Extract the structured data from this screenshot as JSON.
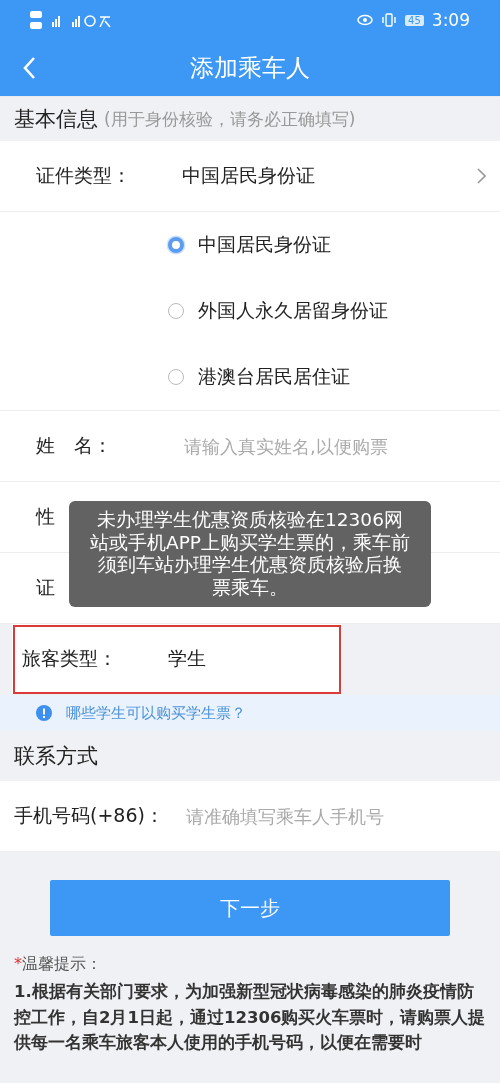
{
  "status_bar": {
    "time": "3:09",
    "battery": "45"
  },
  "header": {
    "title": "添加乘车人"
  },
  "basic_section": {
    "title": "基本信息",
    "note": "(用于身份核验，请务必正确填写)"
  },
  "id_type": {
    "label": "证件类型：",
    "value": "中国居民身份证"
  },
  "id_options": [
    {
      "label": "中国居民身份证",
      "selected": true
    },
    {
      "label": "外国人永久居留身份证",
      "selected": false
    },
    {
      "label": "港澳台居民居住证",
      "selected": false
    }
  ],
  "fields": [
    {
      "kind": "input",
      "label": "姓　名：",
      "placeholder": "请输入真实姓名,以便购票"
    },
    {
      "kind": "label",
      "label": "性"
    },
    {
      "kind": "label",
      "label": "证"
    },
    {
      "kind": "value",
      "label": "旅客类型：",
      "value": "学生",
      "highlighted": true
    }
  ],
  "toast": "未办理学生优惠资质核验在12306网站或手机APP上购买学生票的，乘车前须到车站办理学生优惠资质核验后换票乘车。",
  "student_link": "哪些学生可以购买学生票？",
  "contact_section": {
    "title": "联系方式"
  },
  "phone": {
    "label": "手机号码(+86)：",
    "placeholder": "请准确填写乘车人手机号"
  },
  "next_button": "下一步",
  "tips": {
    "mark": "*",
    "title": "温馨提示：",
    "text": "1.根据有关部门要求，为加强新型冠状病毒感染的肺炎疫情防控工作，自2月1日起，通过12306购买火车票时，请购票人提供每一名乘车旅客本人使用的手机号码，以便在需要时"
  }
}
